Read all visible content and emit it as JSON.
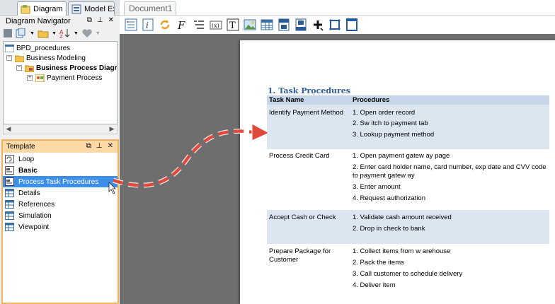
{
  "left_tabs": [
    {
      "label": "Diagram ...",
      "icon": "diagram-icon",
      "active": true
    },
    {
      "label": "Model Ex...",
      "icon": "model-explorer-icon",
      "active": false
    }
  ],
  "navigator": {
    "title": "Diagram Navigator",
    "controls": [
      "⧉",
      "⊥",
      "✕"
    ],
    "tree": [
      {
        "label": "BPD_procedures",
        "icon": "project-icon",
        "expander": "",
        "bold": false
      },
      {
        "label": "Business Modeling",
        "icon": "folder-icon",
        "expander": "−",
        "bold": false
      },
      {
        "label": "Business Process Diagram",
        "icon": "folder-icon",
        "expander": "−",
        "bold": true
      },
      {
        "label": "Payment Process",
        "icon": "bpd-diagram-icon",
        "expander": "+",
        "bold": false
      }
    ]
  },
  "template_panel": {
    "title": "Template",
    "controls": [
      "⧉",
      "⊥",
      "✕"
    ],
    "items": [
      {
        "label": "Loop",
        "icon": "loop-icon",
        "bold": false,
        "selected": false
      },
      {
        "label": "Basic",
        "icon": "basic-icon",
        "bold": true,
        "selected": false
      },
      {
        "label": "Process Task Procedures",
        "icon": "template-icon",
        "bold": false,
        "selected": true
      },
      {
        "label": "Details",
        "icon": "table-icon",
        "bold": false,
        "selected": false
      },
      {
        "label": "References",
        "icon": "table-icon",
        "bold": false,
        "selected": false
      },
      {
        "label": "Simulation",
        "icon": "table-icon",
        "bold": false,
        "selected": false
      },
      {
        "label": "Viewpoint",
        "icon": "table-icon",
        "bold": false,
        "selected": false
      }
    ]
  },
  "document_tab": "Document1",
  "toolbar_icons": [
    "table-of-contents-icon",
    "info-icon",
    "refresh-icon",
    "font-icon",
    "list-icon",
    "formula-icon",
    "text-icon",
    "image-icon",
    "table-icon",
    "page-header-icon",
    "page-footer-icon",
    "add-icon",
    "page-border-icon",
    "page-icon"
  ],
  "document": {
    "heading": "1. Task Procedures",
    "columns": [
      "Task Name",
      "Procedures"
    ],
    "rows": [
      {
        "task": "Identify Payment Method",
        "steps": [
          "1. Open order record",
          "2. Sw itch to payment tab",
          "3. Lookup payment method"
        ]
      },
      {
        "task": "Process Credit Card",
        "steps": [
          "1. Open payment gatew ay page",
          "2. Enter card holder name, card number, exp date and CVV code to payment gatew ay",
          "3. Enter amount",
          "4. Request authorization"
        ]
      },
      {
        "task": "Accept Cash or Check",
        "steps": [
          "1. Validate cash amount received",
          "2. Drop in check to bank"
        ]
      },
      {
        "task": "Prepare Package for Customer",
        "steps": [
          "1. Collect items from w arehouse",
          "2. Pack the items",
          "3. Call customer to schedule delivery",
          "4. Deliver item"
        ]
      }
    ]
  },
  "colors": {
    "selection": "#3c8ee8",
    "template_border": "#f3b35b",
    "table_header": "#c6d6e8",
    "table_shade": "#dce6f1",
    "heading": "#2e5fa0",
    "arrow": "#e04a3c"
  }
}
